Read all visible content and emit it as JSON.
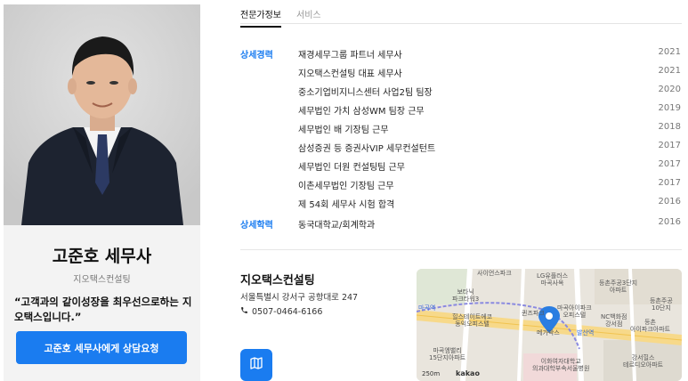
{
  "profile": {
    "name": "고준호 세무사",
    "company": "지오택스컨설팅",
    "motto": "“고객과의 같이성장을 최우선으로하는 지오택스입니다.”",
    "cta_label": "고준호 세무사에게 상담요청"
  },
  "tabs": [
    {
      "label": "전문가정보",
      "active": true
    },
    {
      "label": "서비스",
      "active": false
    }
  ],
  "career": {
    "label": "상세경력",
    "items": [
      {
        "text": "재경세무그룹 파트너 세무사",
        "year": "2021"
      },
      {
        "text": "지오택스컨설팅 대표 세무사",
        "year": "2021"
      },
      {
        "text": "중소기업비지니스센터 사업2팀 팀장",
        "year": "2020"
      },
      {
        "text": "세무법인 가치 삼성WM 팀장 근무",
        "year": "2019"
      },
      {
        "text": "세무법인 배 기장팀 근무",
        "year": "2018"
      },
      {
        "text": "삼성증권 등 증권사VIP 세무컨설턴트",
        "year": "2017"
      },
      {
        "text": "세무법인 더원 컨설팅팀 근무",
        "year": "2017"
      },
      {
        "text": "이촌세무법인 기장팀 근무",
        "year": "2017"
      },
      {
        "text": "제 54회 세무사 시험 합격",
        "year": "2016"
      }
    ]
  },
  "education": {
    "label": "상세학력",
    "items": [
      {
        "text": "동국대학교/회계학과",
        "year": "2016"
      }
    ]
  },
  "office": {
    "name": "지오택스컨설팅",
    "address": "서울특별시 강서구 공항대로 247",
    "phone": "0507-0464-6166"
  },
  "map": {
    "labels": {
      "l1": "사이언스파크",
      "l2": "LG유플러스",
      "l3": "마곡사옥",
      "l4": "등촌주공3단지",
      "l5": "아파트",
      "l6": "보타닉",
      "l7": "파크타워3",
      "l8": "마곡역",
      "l9": "힐스테이트에코",
      "l10": "동익오피스텔",
      "l11": "퀸즈파크",
      "l12": "마곡아이파크",
      "l13": "오피스텔",
      "l14": "NC백화점",
      "l15": "강서점",
      "l16": "등촌주공",
      "l17": "10단지",
      "l18": "등촌",
      "l19": "아이파크아파트",
      "l20": "메가박스",
      "l21": "이화여자대학교",
      "l22": "의과대학부속서울병원",
      "l23": "마곡엠밸리",
      "l24": "15단지아파트",
      "l25": "강서힐스",
      "l26": "테르디오아파트",
      "l27": "발산역"
    },
    "scale": "250m",
    "brand": "kakao"
  },
  "colors": {
    "accent": "#1a7cf0",
    "card_bg": "#f3f3f3"
  },
  "icons": {
    "phone": "phone-icon",
    "map": "map-icon",
    "pin": "location-pin-icon"
  }
}
